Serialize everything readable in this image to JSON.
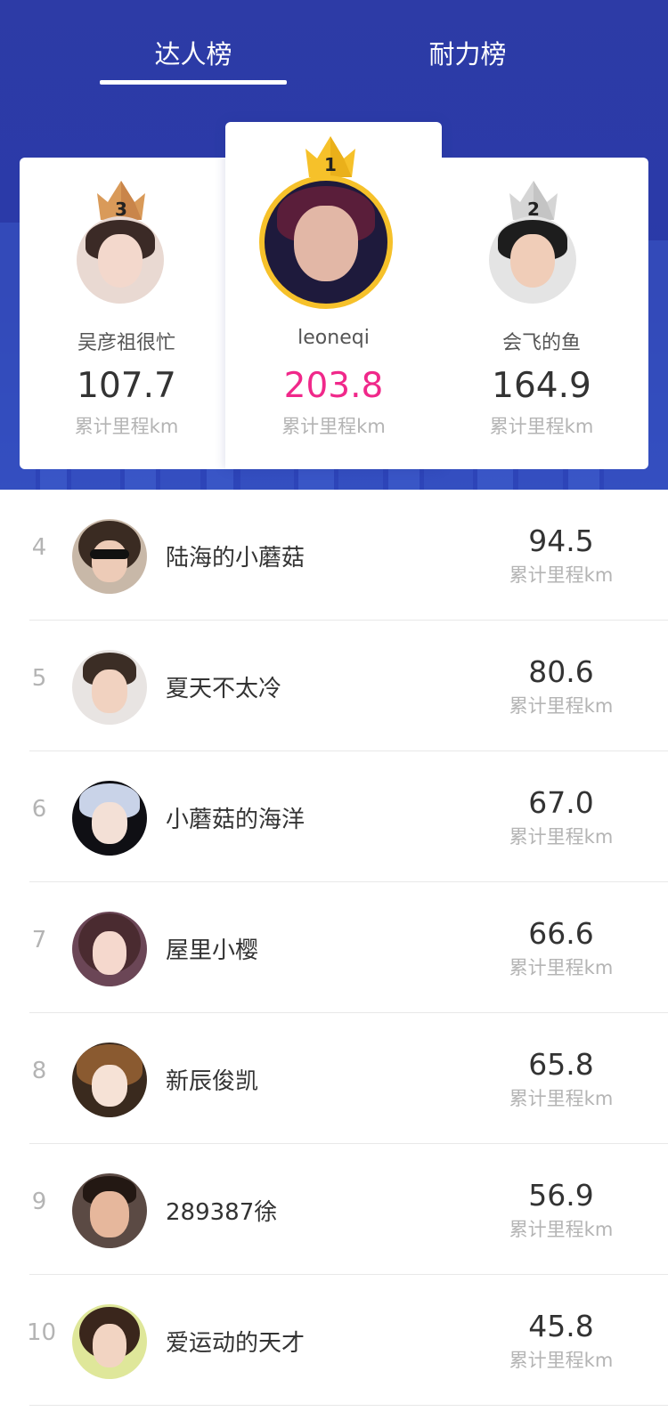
{
  "tabs": [
    {
      "label": "达人榜"
    },
    {
      "label": "耐力榜"
    }
  ],
  "active_tab": "达人榜",
  "colors": {
    "header_bg": "#2b3ba7",
    "first_value": "#f0288a",
    "gold": "#f6c12a",
    "silver": "#d5d5d5",
    "bronze": "#d99a59"
  },
  "podium": {
    "first": {
      "rank": "1",
      "name": "leoneqi",
      "value": "203.8",
      "unit": "累计里程km"
    },
    "second": {
      "rank": "2",
      "name": "会飞的鱼",
      "value": "164.9",
      "unit": "累计里程km"
    },
    "third": {
      "rank": "3",
      "name": "吴彦祖很忙",
      "value": "107.7",
      "unit": "累计里程km"
    }
  },
  "ranking": [
    {
      "rank": "4",
      "name": "陆海的小蘑菇",
      "value": "94.5",
      "unit": "累计里程km"
    },
    {
      "rank": "5",
      "name": "夏天不太冷",
      "value": "80.6",
      "unit": "累计里程km"
    },
    {
      "rank": "6",
      "name": "小蘑菇的海洋",
      "value": "67.0",
      "unit": "累计里程km"
    },
    {
      "rank": "7",
      "name": "屋里小樱",
      "value": "66.6",
      "unit": "累计里程km"
    },
    {
      "rank": "8",
      "name": "新辰俊凯",
      "value": "65.8",
      "unit": "累计里程km"
    },
    {
      "rank": "9",
      "name": "289387徐",
      "value": "56.9",
      "unit": "累计里程km"
    },
    {
      "rank": "10",
      "name": "爱运动的天才",
      "value": "45.8",
      "unit": "累计里程km"
    }
  ]
}
